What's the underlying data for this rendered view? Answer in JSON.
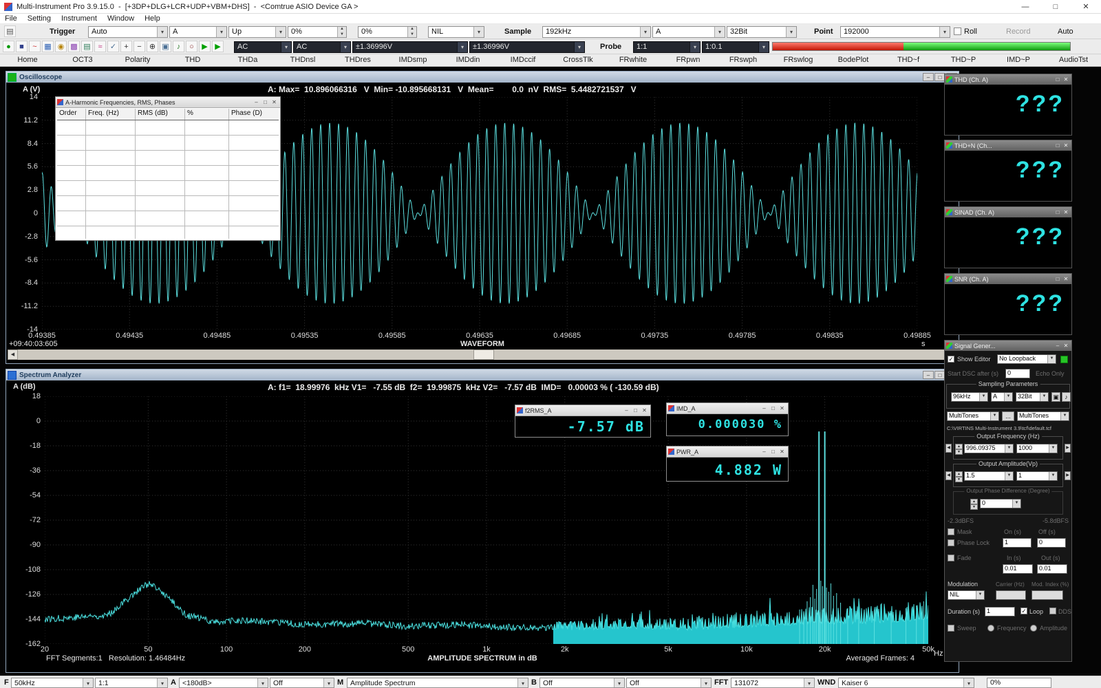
{
  "window": {
    "title": "Multi-Instrument Pro 3.9.15.0  -  [+3DP+DLG+LCR+UDP+VBM+DHS]  -  <Comtrue ASIO Device GA >",
    "minimize_glyph": "—",
    "maximize_glyph": "□",
    "close_glyph": "✕"
  },
  "menu": {
    "items": [
      "File",
      "Setting",
      "Instrument",
      "Window",
      "Help"
    ]
  },
  "toolbar1": {
    "trigger_label": "Trigger",
    "trigger_mode": "Auto",
    "trigger_source": "A",
    "trigger_edge": "Up",
    "trigger_level": "0%",
    "trigger_delay": "0%",
    "trigger_reject": "NIL",
    "sample_label": "Sample",
    "sample_rate": "192kHz",
    "sample_channel": "A",
    "sample_bits": "32Bit",
    "point_label": "Point",
    "point_value": "192000",
    "roll_label": "Roll",
    "record_label": "Record",
    "auto_label": "Auto"
  },
  "toolbar2": {
    "coupling_a": "AC",
    "coupling_b": "AC",
    "range_a": "±1.36996V",
    "range_b": "±1.36996V",
    "probe_label": "Probe",
    "probe_a": "1:1",
    "probe_b": "1:0.1",
    "icons": [
      {
        "name": "run-icon",
        "glyph": "●",
        "color": "#009900"
      },
      {
        "name": "stop-icon",
        "glyph": "■",
        "color": "#33418c"
      },
      {
        "name": "oscilloscope-icon",
        "glyph": "~",
        "color": "#cc3333"
      },
      {
        "name": "spectrum-analyzer-icon",
        "glyph": "▦",
        "color": "#2f62b5"
      },
      {
        "name": "multimeter-icon",
        "glyph": "◉",
        "color": "#b8860b"
      },
      {
        "name": "spectrum-3d-icon",
        "glyph": "▩",
        "color": "#8a3fb0"
      },
      {
        "name": "data-logger-icon",
        "glyph": "▤",
        "color": "#2f7d5a"
      },
      {
        "name": "signal-generator-icon",
        "glyph": "≈",
        "color": "#c23b82"
      },
      {
        "name": "device-test-plan-icon",
        "glyph": "✓",
        "color": "#4a6f94"
      },
      {
        "name": "zoom-in-icon",
        "glyph": "+",
        "color": "#333333"
      },
      {
        "name": "zoom-out-icon",
        "glyph": "−",
        "color": "#333333"
      },
      {
        "name": "cursor-reader-icon",
        "glyph": "⊕",
        "color": "#333333"
      },
      {
        "name": "copy-window-icon",
        "glyph": "▣",
        "color": "#4a6f94"
      },
      {
        "name": "sound-output-icon",
        "glyph": "♪",
        "color": "#2f7d2f"
      },
      {
        "name": "sound-input-icon",
        "glyph": "○",
        "color": "#8c3333"
      },
      {
        "name": "play-channel-a-icon",
        "glyph": "▶",
        "color": "#00a000"
      },
      {
        "name": "play-channel-b-icon",
        "glyph": "▶",
        "color": "#00a000"
      }
    ]
  },
  "tabs": [
    "Home",
    "OCT3",
    "Polarity",
    "THD",
    "THDa",
    "THDnsl",
    "THDres",
    "IMDsmp",
    "IMDdin",
    "IMDccif",
    "CrossTlk",
    "FRwhite",
    "FRpwn",
    "FRswph",
    "FRswlog",
    "BodePlot",
    "THD~f",
    "THD~P",
    "IMD~P",
    "AudioTst"
  ],
  "oscilloscope": {
    "title": "Oscilloscope",
    "stats": "A: Max=  10.896066316   V  Min= -10.895668131   V  Mean=        0.0  nV  RMS=  5.4482721537   V",
    "y_axis_label": "A (V)",
    "y_ticks": [
      "14",
      "11.2",
      "8.4",
      "5.6",
      "2.8",
      "0",
      "-2.8",
      "-5.6",
      "-8.4",
      "-11.2",
      "-14"
    ],
    "x_ticks": [
      "0.49385",
      "0.49435",
      "0.49485",
      "0.49535",
      "0.49585",
      "0.49635",
      "0.49685",
      "0.49735",
      "0.49785",
      "0.49835",
      "0.49885"
    ],
    "x_unit": "s",
    "bottom_label": "WAVEFORM",
    "timestamp": "+09:40:03:605",
    "logo": "Mi"
  },
  "harmonic_window": {
    "title": "A-Harmonic Frequencies, RMS, Phases",
    "columns": [
      "Order",
      "Freq. (Hz)",
      "RMS (dB)",
      "%",
      "Phase (D)"
    ],
    "row_count": 8
  },
  "spectrum": {
    "title": "Spectrum Analyzer",
    "stats": "A: f1=  18.99976  kHz V1=   -7.55 dB  f2=  19.99875  kHz V2=   -7.57 dB  IMD=   0.00003 % ( -130.59 dB)",
    "y_axis_label": "A (dB)",
    "y_ticks": [
      "18",
      "0",
      "-18",
      "-36",
      "-54",
      "-72",
      "-90",
      "-108",
      "-126",
      "-144",
      "-162"
    ],
    "x_ticks": [
      "20",
      "50",
      "100",
      "200",
      "500",
      "1k",
      "2k",
      "5k",
      "10k",
      "20k",
      "50k"
    ],
    "x_unit": "Hz",
    "bottom_left": "FFT Segments:1   Resolution: 1.46484Hz",
    "bottom_center": "AMPLITUDE SPECTRUM in dB",
    "bottom_right": "Averaged Frames: 4",
    "logo": "Mi"
  },
  "meters": [
    {
      "title": "f2RMS_A",
      "value": "-7.57 dB"
    },
    {
      "title": "IMD_A",
      "value": "0.000030 %"
    },
    {
      "title": "PWR_A",
      "value": "4.882 W"
    }
  ],
  "side_panels": [
    {
      "title": "THD (Ch. A)",
      "value": "???"
    },
    {
      "title": "THD+N (Ch...",
      "value": "???"
    },
    {
      "title": "SINAD (Ch. A)",
      "value": "???"
    },
    {
      "title": "SNR (Ch. A)",
      "value": "???"
    }
  ],
  "signal_generator": {
    "title": "Signal Gener...",
    "show_editor_label": "Show Editor",
    "loopback_value": "No Loopback",
    "start_dsc_label": "Start DSC after (s)",
    "start_dsc_value": "0",
    "echo_only_label": "Echo Only",
    "sampling_group_label": "Sampling Parameters",
    "sampling_rate": "96kHz",
    "sampling_channel": "A",
    "sampling_bits": "32Bit",
    "wave_type_a": "MultiTones",
    "browse_label": "...",
    "wave_type_b": "MultiTones",
    "file_path": "C:\\VIRTINS Multi-Instrument 3.9\\tcf\\default.tcf",
    "freq_group_label": "Output Frequency (Hz)",
    "freq_a": "996.09375",
    "freq_b": "1000",
    "amp_group_label": "Output Amplitude(Vp)",
    "amp_a": "1.5",
    "amp_b": "1",
    "phase_group_label": "Output Phase Difference (Degree)",
    "phase_value": "0",
    "dbfs_left": "-2.3dBFS",
    "dbfs_right": "-5.8dBFS",
    "mask_label": "Mask",
    "on_label": "On (s)",
    "off_label": "Off (s)",
    "phase_lock_label": "Phase Lock",
    "mask_on_value": "1",
    "mask_off_value": "0",
    "fade_label": "Fade",
    "fade_in_label": "In (s)",
    "fade_out_label": "Out (s)",
    "fade_in_value": "0.01",
    "fade_out_value": "0.01",
    "modulation_label": "Modulation",
    "carrier_label": "Carrier (Hz)",
    "mod_index_label": "Mod. Index (%)",
    "modulation_value": "NIL",
    "carrier_value": "",
    "mod_index_value": "",
    "duration_label": "Duration (s)",
    "duration_value": "1",
    "loop_label": "Loop",
    "dds_label": "DDS",
    "sweep_label": "Sweep",
    "sweep_freq_label": "Frequency",
    "sweep_amp_label": "Amplitude"
  },
  "status_bar": {
    "f_label": "F",
    "f_value": "50kHz",
    "probe_value": "1:1",
    "a_label": "A",
    "a_range": "<180dB>",
    "a_mode": "Off",
    "m_label": "M",
    "m_value": "Amplitude Spectrum",
    "b_label": "B",
    "b_range": "Off",
    "b_mode": "Off",
    "fft_label": "FFT",
    "fft_value": "131072",
    "wnd_label": "WND",
    "wnd_value": "Kaiser 6",
    "progress": "0%"
  },
  "chart_data": [
    {
      "type": "line",
      "name": "oscilloscope-waveform",
      "title": "WAVEFORM",
      "x_range_s": [
        0.49385,
        0.49885
      ],
      "y_range_v": [
        -14,
        14
      ],
      "signal": {
        "f1_hz": 18999.76,
        "amp1_vpk": 5.448,
        "f2_hz": 19998.75,
        "amp2_vpk": 5.448
      },
      "stats": {
        "max_v": 10.896066316,
        "min_v": -10.895668131,
        "mean_nv": 0.0,
        "rms_v": 5.4482721537
      }
    },
    {
      "type": "line",
      "name": "amplitude-spectrum",
      "title": "AMPLITUDE SPECTRUM in dB",
      "x_scale": "log",
      "x_range_hz": [
        20,
        50000
      ],
      "y_range_db": [
        18,
        -162
      ],
      "seed": 77,
      "noise_profile": [
        [
          20,
          -144
        ],
        [
          35,
          -141
        ],
        [
          45,
          -124
        ],
        [
          50,
          -118
        ],
        [
          58,
          -126
        ],
        [
          70,
          -141
        ],
        [
          90,
          -146
        ],
        [
          120,
          -145
        ],
        [
          200,
          -148
        ],
        [
          350,
          -147
        ],
        [
          500,
          -149
        ],
        [
          800,
          -148
        ],
        [
          1200,
          -150
        ],
        [
          2000,
          -150
        ],
        [
          3500,
          -149
        ],
        [
          6000,
          -150
        ],
        [
          10000,
          -148
        ],
        [
          14000,
          -147
        ],
        [
          18000,
          -145
        ],
        [
          22000,
          -146
        ],
        [
          30000,
          -145
        ],
        [
          40000,
          -144
        ],
        [
          50000,
          -142
        ]
      ],
      "peaks": [
        {
          "f_hz": 18999.76,
          "db": -7.55
        },
        {
          "f_hz": 19998.75,
          "db": -7.57
        },
        {
          "f_hz": 16000,
          "db": -137
        },
        {
          "f_hz": 16600,
          "db": -139
        },
        {
          "f_hz": 17100,
          "db": -131
        },
        {
          "f_hz": 17600,
          "db": -128
        },
        {
          "f_hz": 18000,
          "db": -119
        },
        {
          "f_hz": 18300,
          "db": -129
        },
        {
          "f_hz": 18600,
          "db": -122
        },
        {
          "f_hz": 19300,
          "db": -116
        },
        {
          "f_hz": 19600,
          "db": -120
        },
        {
          "f_hz": 20300,
          "db": -121
        },
        {
          "f_hz": 20700,
          "db": -124
        },
        {
          "f_hz": 21100,
          "db": -118
        },
        {
          "f_hz": 21600,
          "db": -127
        },
        {
          "f_hz": 22200,
          "db": -125
        },
        {
          "f_hz": 23000,
          "db": -132
        },
        {
          "f_hz": 24500,
          "db": -136
        },
        {
          "f_hz": 27000,
          "db": -139
        },
        {
          "f_hz": 31000,
          "db": -137
        },
        {
          "f_hz": 36000,
          "db": -140
        },
        {
          "f_hz": 41000,
          "db": -136
        },
        {
          "f_hz": 45000,
          "db": -134
        },
        {
          "f_hz": 48000,
          "db": -131
        }
      ]
    }
  ]
}
